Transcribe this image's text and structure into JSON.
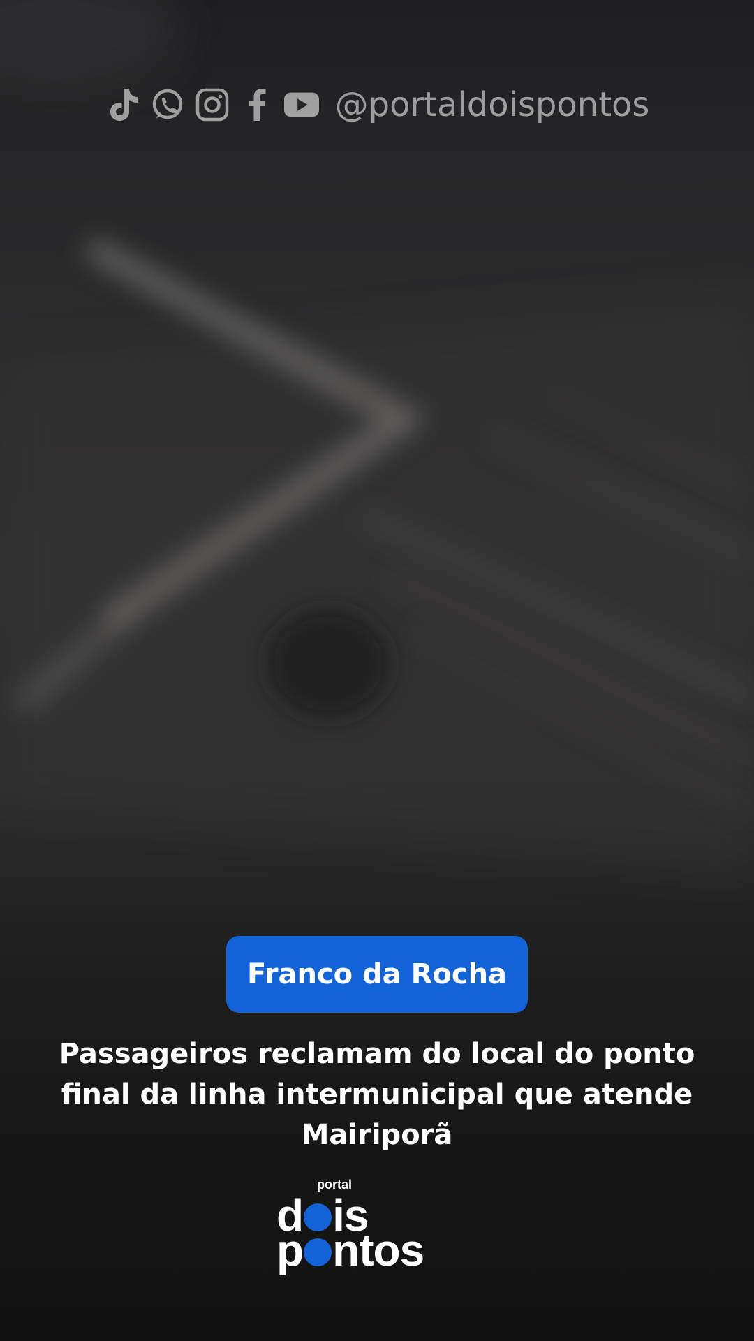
{
  "social": {
    "icons": [
      "tiktok-icon",
      "whatsapp-icon",
      "instagram-icon",
      "facebook-icon",
      "youtube-icon"
    ],
    "handle": "@portaldoispontos"
  },
  "badge": {
    "label": "Franco da Rocha",
    "color": "#1363d8"
  },
  "headline": {
    "text": "Passageiros reclamam do local do ponto final da linha intermunicipal que atende Mairiporã"
  },
  "logo": {
    "small": "portal",
    "line1_prefix": "d",
    "line1_suffix": "is",
    "line2_prefix": "p",
    "line2_suffix": "ntos",
    "accent": "#1363d8"
  }
}
